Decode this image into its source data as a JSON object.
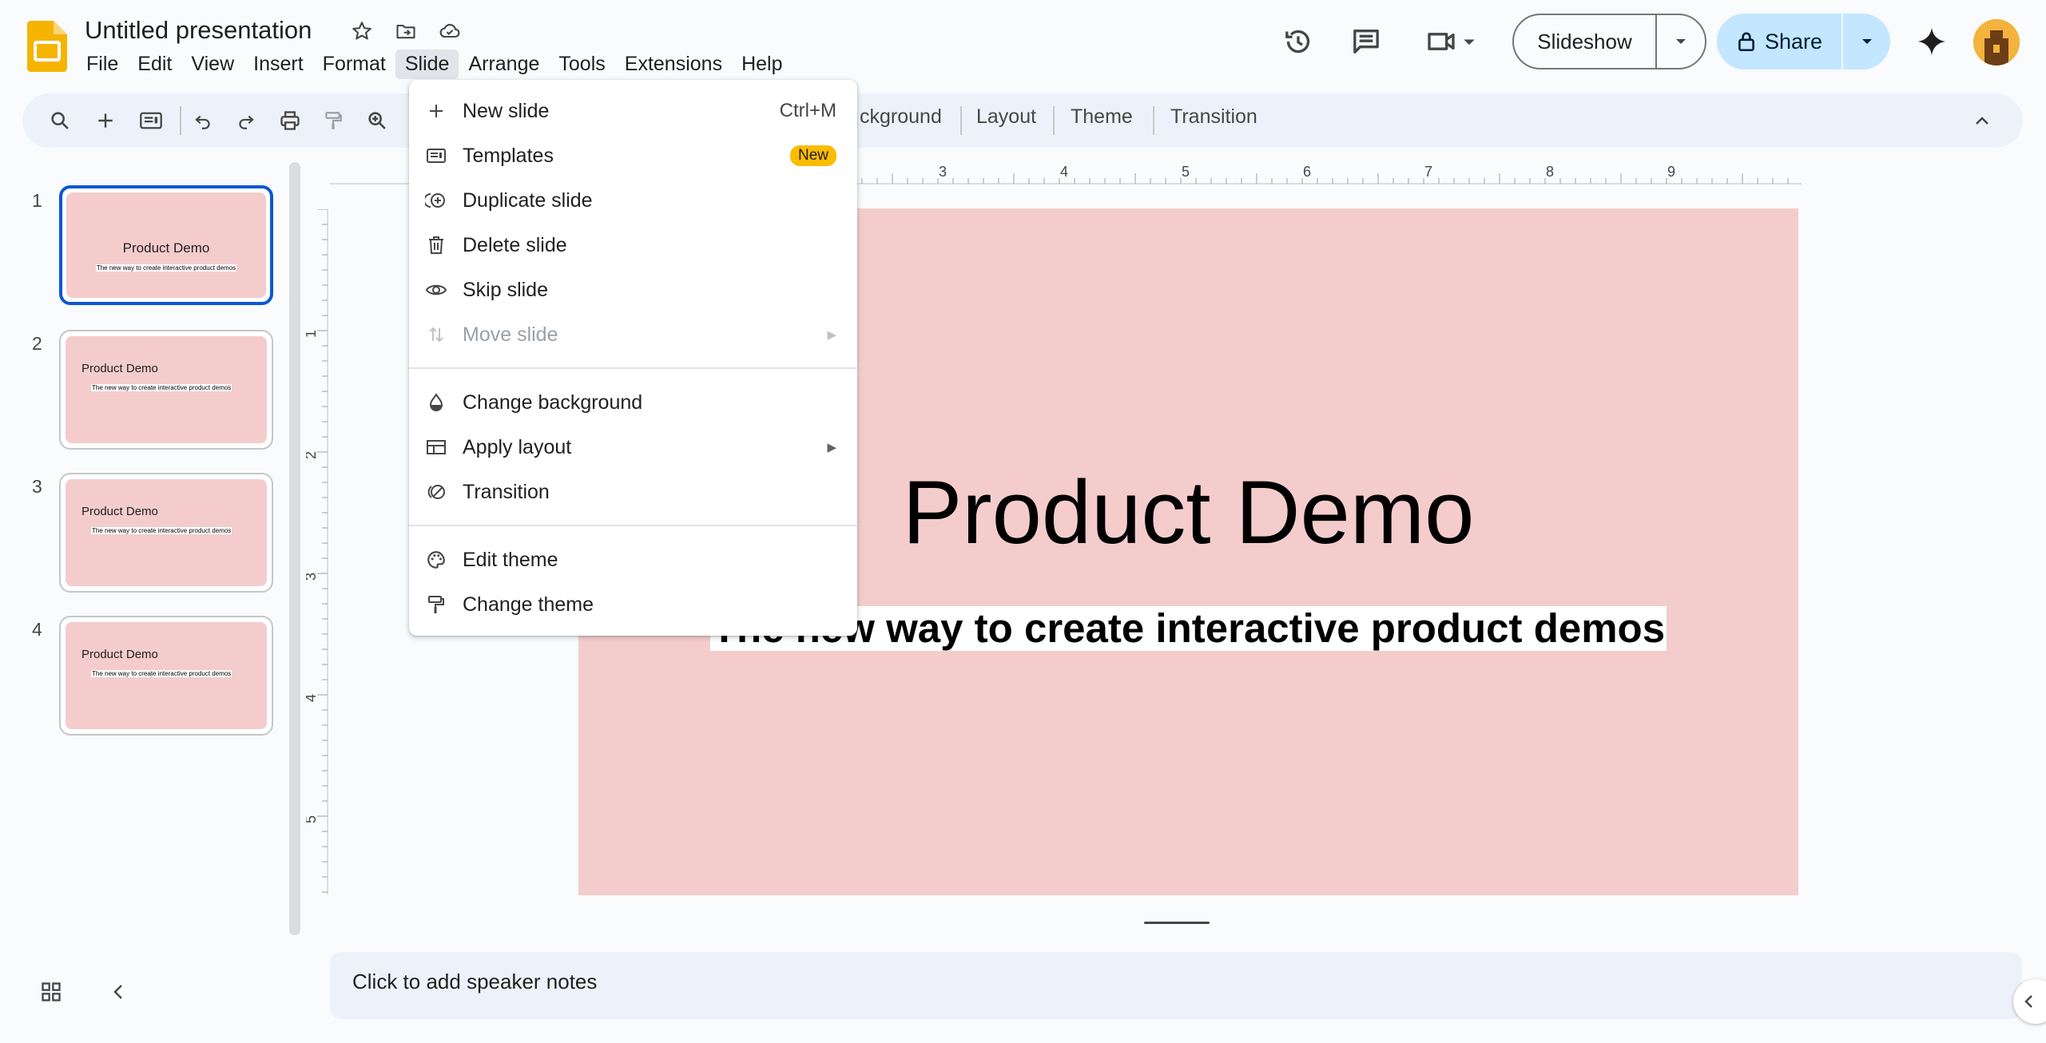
{
  "app": {
    "title": "Untitled presentation",
    "icons": [
      "slides-logo-icon",
      "star-icon",
      "move-to-folder-icon",
      "cloud-saved-icon"
    ]
  },
  "menubar": {
    "items": [
      "File",
      "Edit",
      "View",
      "Insert",
      "Format",
      "Slide",
      "Arrange",
      "Tools",
      "Extensions",
      "Help"
    ],
    "active": "Slide"
  },
  "top_right": {
    "slideshow_label": "Slideshow",
    "share_label": "Share",
    "icons": [
      "version-history-icon",
      "comments-icon",
      "meet-camera-icon",
      "gemini-sparkle-icon",
      "avatar"
    ]
  },
  "toolbar": {
    "visible_labels": [
      "ckground",
      "Layout",
      "Theme",
      "Transition"
    ],
    "icons": [
      "search-icon",
      "plus-icon",
      "new-slide-layout-icon",
      "undo-icon",
      "redo-icon",
      "print-icon",
      "paint-format-icon",
      "zoom-icon",
      "collapse-chevron-icon"
    ]
  },
  "filmstrip": {
    "slides": [
      {
        "number": "1",
        "title": "Product Demo",
        "subtitle": "The new way to create interactive product demos",
        "selected": true
      },
      {
        "number": "2",
        "title": "Product Demo",
        "subtitle": "The new way to create interactive product demos",
        "selected": false
      },
      {
        "number": "3",
        "title": "Product Demo",
        "subtitle": "The new way to create interactive product demos",
        "selected": false
      },
      {
        "number": "4",
        "title": "Product Demo",
        "subtitle": "The new way to create interactive product demos",
        "selected": false
      }
    ]
  },
  "rulers": {
    "horizontal_labels": [
      "3",
      "4",
      "5",
      "6",
      "7",
      "8",
      "9"
    ],
    "vertical_labels": [
      "1",
      "2",
      "3",
      "4",
      "5"
    ]
  },
  "slide": {
    "title": "Product Demo",
    "subtitle": "The new way to create interactive product demos",
    "background": "#f4cccc"
  },
  "notes": {
    "placeholder": "Click to add speaker notes"
  },
  "slide_menu": {
    "items": [
      {
        "label": "New slide",
        "icon": "plus-icon",
        "shortcut": "Ctrl+M"
      },
      {
        "label": "Templates",
        "icon": "templates-icon",
        "badge": "New"
      },
      {
        "label": "Duplicate slide",
        "icon": "duplicate-icon"
      },
      {
        "label": "Delete slide",
        "icon": "trash-icon"
      },
      {
        "label": "Skip slide",
        "icon": "eye-icon"
      },
      {
        "label": "Move slide",
        "icon": "move-arrows-icon",
        "disabled": true,
        "submenu": true
      },
      {
        "label": "Change background",
        "icon": "drop-icon"
      },
      {
        "label": "Apply layout",
        "icon": "layout-icon",
        "submenu": true
      },
      {
        "label": "Transition",
        "icon": "transition-icon"
      },
      {
        "label": "Edit theme",
        "icon": "palette-icon"
      },
      {
        "label": "Change theme",
        "icon": "paint-roller-icon"
      }
    ]
  },
  "colors": {
    "accent": "#0b57d0",
    "share_bg": "#c2e7ff",
    "slide_bg": "#f4cccc",
    "new_badge": "#fbbc04"
  }
}
